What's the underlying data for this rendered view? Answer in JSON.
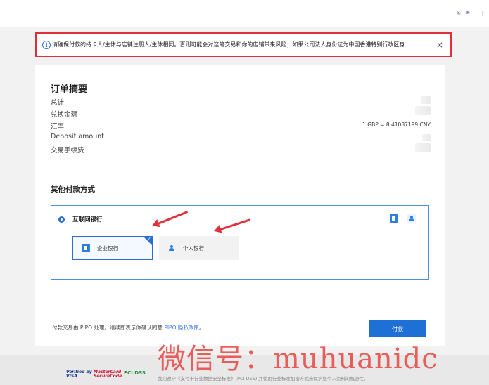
{
  "header": {
    "top_right_label": "多 考",
    "top_right_sep": "|"
  },
  "alert": {
    "info_glyph": "i",
    "text": "请确保付款的持卡人/主体与店铺注册人/主体相同。否则可能会对这笔交易和你的店铺带来风险；如果公司法人身份证为中国香港特别行政区身",
    "close_label": "×"
  },
  "summary": {
    "title": "订单摘要",
    "rows": [
      {
        "label": "总计",
        "value": ""
      },
      {
        "label": "兑换金额",
        "value": ""
      },
      {
        "label": "汇率",
        "value": "1 GBP = 8.41087199 CNY"
      },
      {
        "label": "Deposit amount",
        "value": ""
      },
      {
        "label": "交易手续费",
        "value": ""
      }
    ]
  },
  "payment": {
    "title": "其他付款方式",
    "method_label": "互联网银行",
    "options": [
      {
        "label": "企业银行",
        "selected": true
      },
      {
        "label": "个人银行",
        "selected": false
      }
    ],
    "check_glyph": "✓"
  },
  "footer": {
    "note_prefix": "付款交易由 PIPO 处理。继续即表示你确认同意 ",
    "note_link": "PIPO 隐私政策",
    "note_suffix": "。",
    "pay_button": "付款"
  },
  "bottom_bar": {
    "visa_line1": "Verified by",
    "visa_line2": "VISA",
    "mc_line1": "MasterCard",
    "mc_line2": "SecureCode",
    "pci_label": "PCI DSS",
    "text": "我们遵守《支付卡行业数据安全标准》(PCI DSS) 并使用行业标准加密方式来保护您个人资料的机密性。"
  },
  "watermark": "微信号：muhuanidc",
  "colors": {
    "accent": "#1e6fd6",
    "alert_border": "#e0313a",
    "arrow": "#e0303a"
  }
}
